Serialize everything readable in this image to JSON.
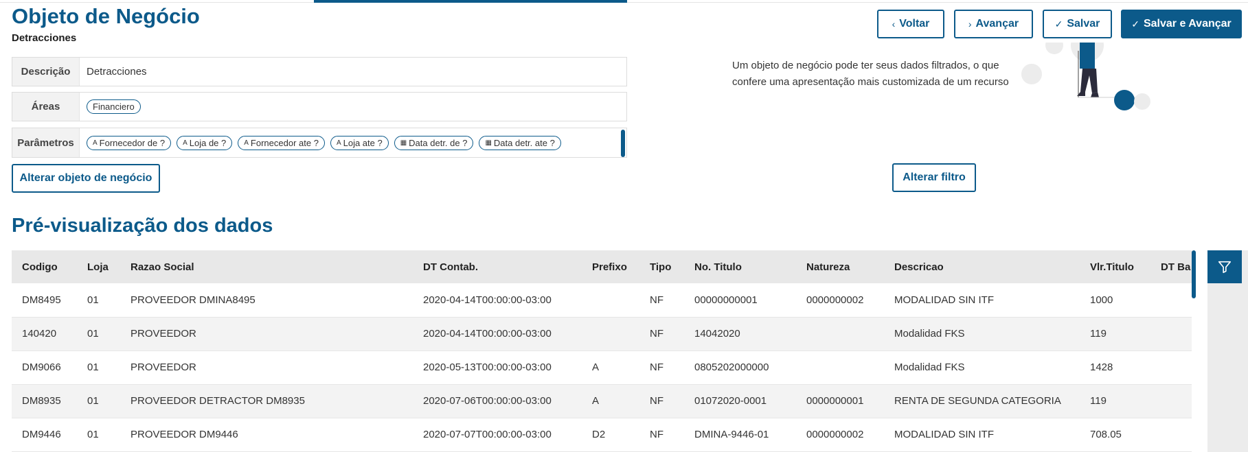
{
  "header": {
    "title": "Objeto de Negócio",
    "subtitle": "Detracciones"
  },
  "actions": {
    "back_label": "Voltar",
    "next_label": "Avançar",
    "save_label": "Salvar",
    "save_next_label": "Salvar e Avançar"
  },
  "fields": {
    "description": {
      "label": "Descrição",
      "value": "Detracciones"
    },
    "areas": {
      "label": "Áreas",
      "chips": [
        "Financiero"
      ]
    },
    "parameters": {
      "label": "Parâmetros",
      "chips": [
        {
          "icon": "text-type-icon",
          "glyph": "A",
          "label": "Fornecedor de ?"
        },
        {
          "icon": "text-type-icon",
          "glyph": "A",
          "label": "Loja de ?"
        },
        {
          "icon": "text-type-icon",
          "glyph": "A",
          "label": "Fornecedor ate ?"
        },
        {
          "icon": "text-type-icon",
          "glyph": "A",
          "label": "Loja ate ?"
        },
        {
          "icon": "calendar-icon",
          "glyph": "▦",
          "label": "Data detr. de ?"
        },
        {
          "icon": "calendar-icon",
          "glyph": "▦",
          "label": "Data detr. ate ?"
        }
      ]
    }
  },
  "change_object_label": "Alterar objeto de negócio",
  "info": {
    "text": "Um objeto de negócio pode ter seus dados filtrados, o que confere uma apresentação mais customizada de um recurso",
    "change_filter_label": "Alterar filtro"
  },
  "preview": {
    "title": "Pré-visualização dos dados",
    "columns": [
      "Codigo",
      "Loja",
      "Razao Social",
      "DT Contab.",
      "Prefixo",
      "Tipo",
      "No. Titulo",
      "Natureza",
      "Descricao",
      "Vlr.Titulo",
      "DT Ba"
    ],
    "rows": [
      [
        "DM8495",
        "01",
        "PROVEEDOR DMINA8495",
        "2020-04-14T00:00:00-03:00",
        "",
        "NF",
        "00000000001",
        "0000000002",
        "MODALIDAD SIN ITF",
        "1000",
        ""
      ],
      [
        "140420",
        "01",
        "PROVEEDOR",
        "2020-04-14T00:00:00-03:00",
        "",
        "NF",
        "14042020",
        "",
        "Modalidad FKS",
        "119",
        ""
      ],
      [
        "DM9066",
        "01",
        "PROVEEDOR",
        "2020-05-13T00:00:00-03:00",
        "A",
        "NF",
        "0805202000000",
        "",
        "Modalidad FKS",
        "1428",
        ""
      ],
      [
        "DM8935",
        "01",
        "PROVEEDOR DETRACTOR DM8935",
        "2020-07-06T00:00:00-03:00",
        "A",
        "NF",
        "01072020-0001",
        "0000000001",
        "RENTA DE SEGUNDA CATEGORIA",
        "119",
        ""
      ],
      [
        "DM9446",
        "01",
        "PROVEEDOR DM9446",
        "2020-07-07T00:00:00-03:00",
        "D2",
        "NF",
        "DMINA-9446-01",
        "0000000002",
        "MODALIDAD SIN ITF",
        "708.05",
        ""
      ]
    ]
  },
  "colors": {
    "primary": "#0c5a8a",
    "header_bg": "#e8e8e8",
    "row_alt": "#f3f3f3"
  }
}
